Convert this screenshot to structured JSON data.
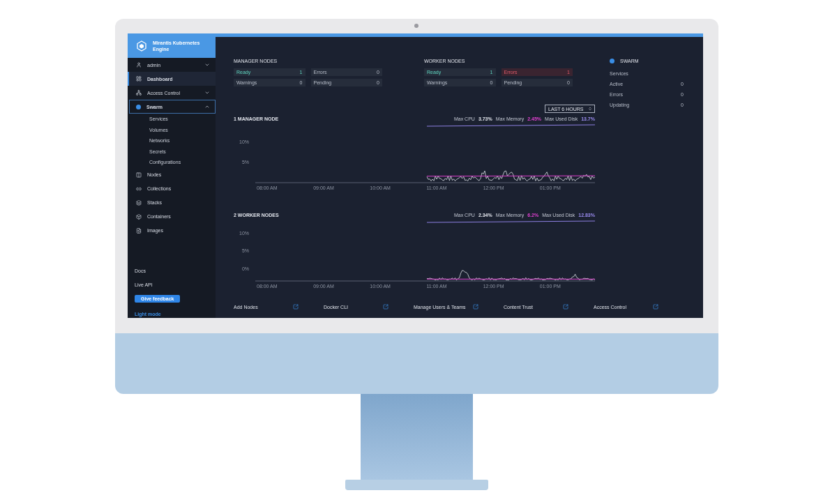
{
  "sidebar": {
    "brand": "Mirantis Kubernetes Engine",
    "items": [
      {
        "label": "admin",
        "selected": false,
        "expanded": false
      },
      {
        "label": "Dashboard",
        "selected": true
      },
      {
        "label": "Access Control",
        "selected": false,
        "expanded": false
      },
      {
        "label": "Swarm",
        "selected": false,
        "expanded": true,
        "children": [
          {
            "label": "Services"
          },
          {
            "label": "Volumes"
          },
          {
            "label": "Networks"
          },
          {
            "label": "Secrets"
          },
          {
            "label": "Configurations"
          }
        ]
      },
      {
        "label": "Nodes",
        "selected": false
      },
      {
        "label": "Collections",
        "selected": false
      },
      {
        "label": "Stacks",
        "selected": false
      },
      {
        "label": "Containers",
        "selected": false
      },
      {
        "label": "Images",
        "selected": false
      }
    ],
    "links": [
      "Docs",
      "Live API"
    ],
    "feedback_button": "Give feedback",
    "mode_link": "Light mode"
  },
  "manager_nodes": {
    "title": "MANAGER NODES",
    "stats": [
      {
        "label": "Ready",
        "value": "1",
        "kind": "ok"
      },
      {
        "label": "Errors",
        "value": "0",
        "kind": "plain"
      },
      {
        "label": "Warnings",
        "value": "0",
        "kind": "plain"
      },
      {
        "label": "Pending",
        "value": "0",
        "kind": "plain"
      }
    ]
  },
  "worker_nodes": {
    "title": "WORKER NODES",
    "stats": [
      {
        "label": "Ready",
        "value": "1",
        "kind": "ok"
      },
      {
        "label": "Errors",
        "value": "1",
        "kind": "alert"
      },
      {
        "label": "Warnings",
        "value": "0",
        "kind": "plain"
      },
      {
        "label": "Pending",
        "value": "0",
        "kind": "plain"
      }
    ]
  },
  "swarm": {
    "title": "SWARM",
    "heading": "Services",
    "rows": [
      {
        "label": "Active",
        "value": "0"
      },
      {
        "label": "Errors",
        "value": "0"
      },
      {
        "label": "Updating",
        "value": "0"
      }
    ]
  },
  "time_range": "LAST 6 HOURS",
  "charts": [
    {
      "title": "1 MANAGER NODE",
      "metrics": [
        {
          "label": "Max CPU",
          "value": "3.73%",
          "kind": "cpu"
        },
        {
          "label": "Max Memory",
          "value": "2.45%",
          "kind": "memory"
        },
        {
          "label": "Max Used Disk",
          "value": "13.7%",
          "kind": "disk"
        }
      ],
      "yticks": [
        "10%",
        "5%"
      ],
      "xticks": [
        "08:00 AM",
        "09:00 AM",
        "10:00 AM",
        "11:00 AM",
        "12:00 PM",
        "01:00 PM"
      ]
    },
    {
      "title": "2 WORKER NODES",
      "metrics": [
        {
          "label": "Max CPU",
          "value": "2.34%",
          "kind": "cpu"
        },
        {
          "label": "Max Memory",
          "value": "6.2%",
          "kind": "memory"
        },
        {
          "label": "Max Used Disk",
          "value": "12.83%",
          "kind": "disk"
        }
      ],
      "yticks": [
        "10%",
        "5%",
        "0%"
      ],
      "xticks": [
        "08:00 AM",
        "09:00 AM",
        "10:00 AM",
        "11:00 AM",
        "12:00 PM",
        "01:00 PM"
      ]
    }
  ],
  "quick_links": [
    "Add Nodes",
    "Docker CLI",
    "Manage Users & Teams",
    "Content Trust",
    "Access Control"
  ]
}
